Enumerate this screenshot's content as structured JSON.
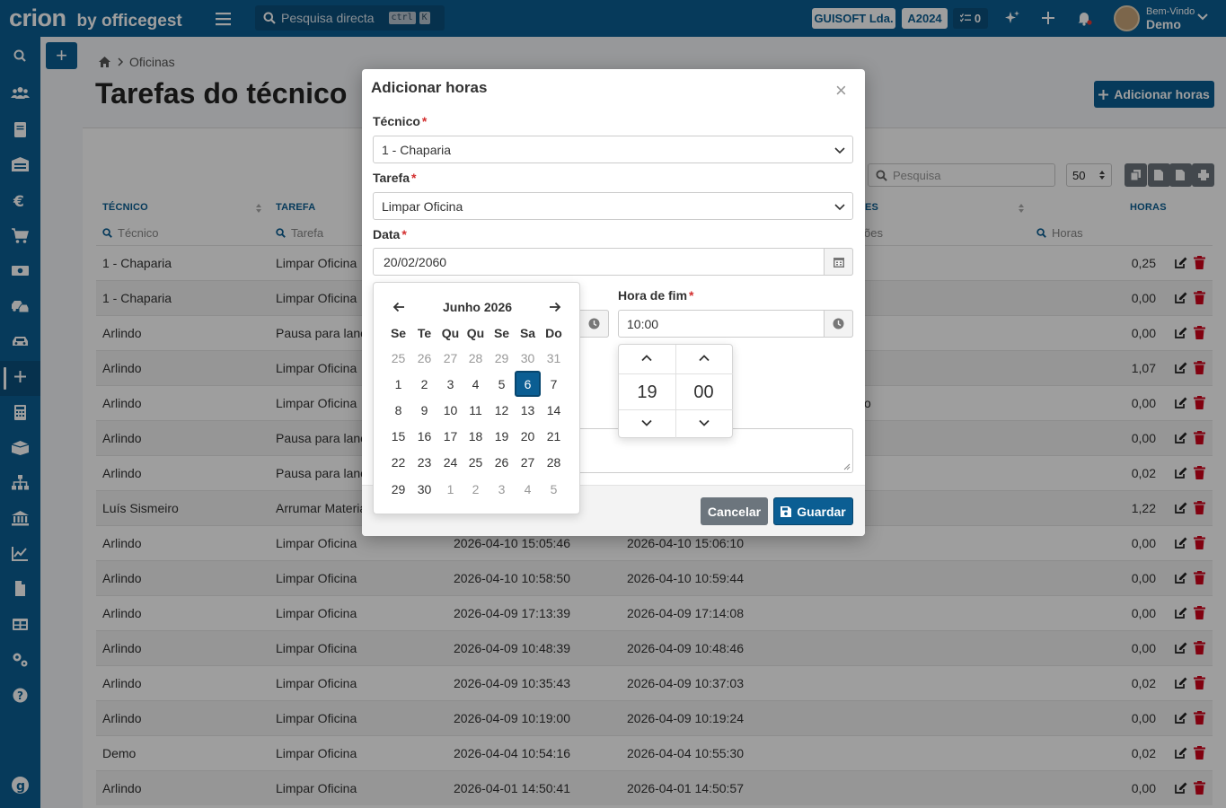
{
  "topbar": {
    "logo_text": "crion",
    "logo_by": "by officegest",
    "search_placeholder": "Pesquisa directa",
    "search_kbd1": "ctrl",
    "search_kbd2": "K",
    "company": "GUISOFT Lda.",
    "year": "A2024",
    "tasks_count": "0",
    "welcome_small": "Bem-Vindo",
    "welcome_name": "Demo"
  },
  "sidebar": {
    "items": [
      "search-icon",
      "users-icon",
      "book-icon",
      "building-icon",
      "euro-icon",
      "cart-icon",
      "money-icon",
      "truck-icon",
      "car-icon",
      "plus-icon",
      "calculator-icon",
      "boxes-icon",
      "sitemap-icon",
      "bank-icon",
      "chart-icon",
      "file-icon",
      "table-icon",
      "settings-icon",
      "help-icon"
    ]
  },
  "page": {
    "breadcrumb": "Oficinas",
    "title": "Tarefas do técnico",
    "add_button": "Adicionar horas",
    "search_placeholder": "Pesquisa",
    "page_size": "50"
  },
  "table": {
    "headers": {
      "tecnico": "TÉCNICO",
      "tarefa": "TAREFA",
      "obs": "ES",
      "horas": "HORAS"
    },
    "filters": {
      "tecnico": "Técnico",
      "tarefa": "Tarefa",
      "obs": "ões",
      "horas": "Horas"
    },
    "rows": [
      {
        "tecnico": "1 - Chaparia",
        "tarefa": "Limpar Oficina",
        "inicio": "",
        "fim": "",
        "horas": "0,25"
      },
      {
        "tecnico": "1 - Chaparia",
        "tarefa": "Limpar Oficina",
        "inicio": "",
        "fim": "",
        "horas": "0,00"
      },
      {
        "tecnico": "Arlindo",
        "tarefa": "Pausa para lanc",
        "inicio": "",
        "fim": "",
        "horas": "0,00"
      },
      {
        "tecnico": "Arlindo",
        "tarefa": "Limpar Oficina",
        "inicio": "",
        "fim": "",
        "horas": "1,07"
      },
      {
        "tecnico": "Arlindo",
        "tarefa": "Limpar Oficina",
        "inicio": "",
        "fim": "",
        "obs": "o",
        "horas": "0,00"
      },
      {
        "tecnico": "Arlindo",
        "tarefa": "Pausa para lanc",
        "inicio": "",
        "fim": "",
        "horas": "0,00"
      },
      {
        "tecnico": "Arlindo",
        "tarefa": "Pausa para lanc",
        "inicio": "",
        "fim": "",
        "horas": "0,02"
      },
      {
        "tecnico": "Luís Sismeiro",
        "tarefa": "Arrumar Materia",
        "inicio": "",
        "fim": "",
        "horas": "1,22"
      },
      {
        "tecnico": "Arlindo",
        "tarefa": "Limpar Oficina",
        "inicio": "2026-04-10 15:05:46",
        "fim": "2026-04-10 15:06:10",
        "horas": "0,00"
      },
      {
        "tecnico": "Arlindo",
        "tarefa": "Limpar Oficina",
        "inicio": "2026-04-10 10:58:50",
        "fim": "2026-04-10 10:59:44",
        "horas": "0,00"
      },
      {
        "tecnico": "Arlindo",
        "tarefa": "Limpar Oficina",
        "inicio": "2026-04-09 17:13:39",
        "fim": "2026-04-09 17:14:08",
        "horas": "0,00"
      },
      {
        "tecnico": "Arlindo",
        "tarefa": "Limpar Oficina",
        "inicio": "2026-04-09 10:48:39",
        "fim": "2026-04-09 10:48:46",
        "horas": "0,00"
      },
      {
        "tecnico": "Arlindo",
        "tarefa": "Limpar Oficina",
        "inicio": "2026-04-09 10:35:43",
        "fim": "2026-04-09 10:37:03",
        "horas": "0,02"
      },
      {
        "tecnico": "Arlindo",
        "tarefa": "Limpar Oficina",
        "inicio": "2026-04-09 10:19:00",
        "fim": "2026-04-09 10:19:24",
        "horas": "0,00"
      },
      {
        "tecnico": "Demo",
        "tarefa": "Limpar Oficina",
        "inicio": "2026-04-04 10:54:16",
        "fim": "2026-04-04 10:55:30",
        "horas": "0,02"
      },
      {
        "tecnico": "Arlindo",
        "tarefa": "Limpar Oficina",
        "inicio": "2026-04-01 14:50:41",
        "fim": "2026-04-01 14:50:57",
        "horas": "0,00"
      }
    ]
  },
  "modal": {
    "title": "Adicionar horas",
    "close": "×",
    "tecnico_label": "Técnico",
    "tecnico_value": "1 - Chaparia",
    "tarefa_label": "Tarefa",
    "tarefa_value": "Limpar Oficina",
    "data_label": "Data",
    "data_value": "20/02/2060",
    "hora_fim_label": "Hora de fim",
    "hora_fim_value": "10:00",
    "required_mark": "*",
    "cancel": "Cancelar",
    "save": "Guardar"
  },
  "datepicker": {
    "month": "Junho 2026",
    "dows": [
      "Se",
      "Te",
      "Qu",
      "Qu",
      "Se",
      "Sa",
      "Do"
    ],
    "weeks": [
      [
        "25",
        "26",
        "27",
        "28",
        "29",
        "30",
        "31"
      ],
      [
        "1",
        "2",
        "3",
        "4",
        "5",
        "6",
        "7"
      ],
      [
        "8",
        "9",
        "10",
        "11",
        "12",
        "13",
        "14"
      ],
      [
        "15",
        "16",
        "17",
        "18",
        "19",
        "20",
        "21"
      ],
      [
        "22",
        "23",
        "24",
        "25",
        "26",
        "27",
        "28"
      ],
      [
        "29",
        "30",
        "1",
        "2",
        "3",
        "4",
        "5"
      ]
    ],
    "selected": "6"
  },
  "timepicker": {
    "hour": "19",
    "minute": "00"
  },
  "colors": {
    "brand": "#0b5e93",
    "danger": "#d0021b",
    "secondary": "#6c757d"
  }
}
